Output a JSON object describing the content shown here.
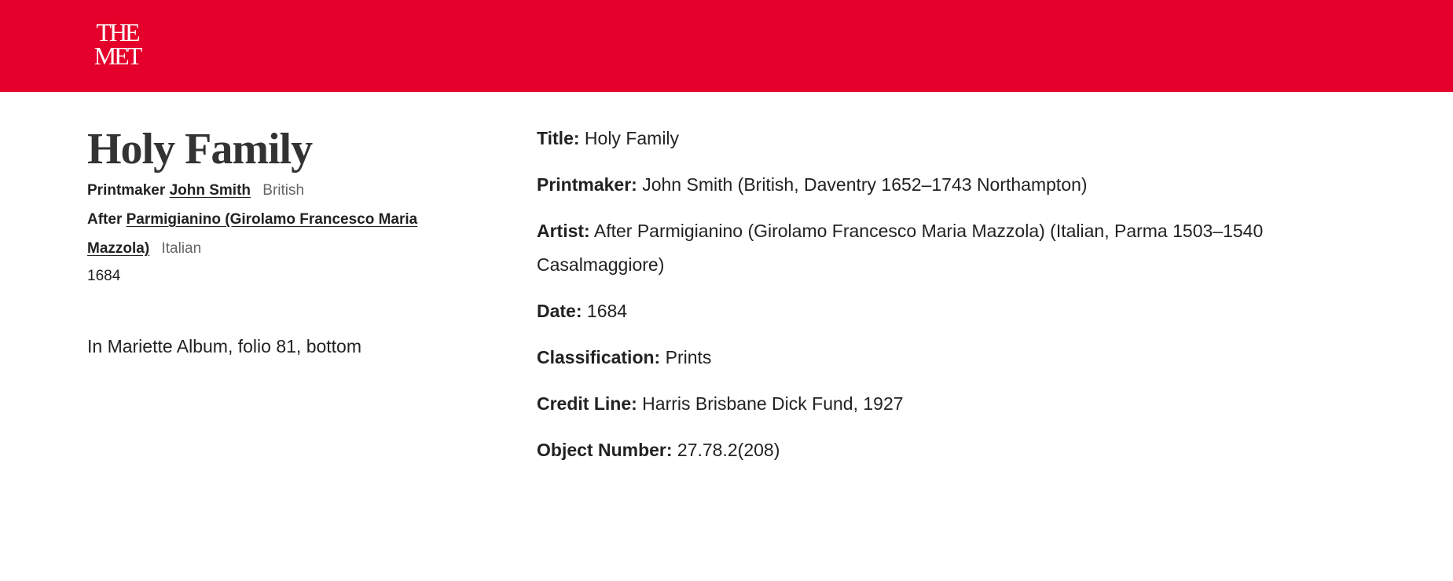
{
  "header": {
    "logo_line1": "THE",
    "logo_line2": "MET",
    "background_color": "#e4002b"
  },
  "object": {
    "title": "Holy Family",
    "printmaker": {
      "role": "Printmaker",
      "name": "John Smith",
      "nationality": "British"
    },
    "artist": {
      "role": "After",
      "name": "Parmigianino (Girolamo Francesco Maria Mazzola)",
      "nationality": "Italian"
    },
    "date": "1684",
    "description": "In Mariette Album, folio 81, bottom"
  },
  "details": {
    "title_label": "Title:",
    "title_value": "Holy Family",
    "printmaker_label": "Printmaker:",
    "printmaker_value": "John Smith (British, Daventry 1652–1743 Northampton)",
    "artist_label": "Artist:",
    "artist_value": "After Parmigianino (Girolamo Francesco Maria Mazzola) (Italian, Parma 1503–1540 Casalmaggiore)",
    "date_label": "Date:",
    "date_value": "1684",
    "classification_label": "Classification:",
    "classification_value": "Prints",
    "credit_label": "Credit Line:",
    "credit_value": "Harris Brisbane Dick Fund, 1927",
    "object_number_label": "Object Number:",
    "object_number_value": "27.78.2(208)"
  }
}
